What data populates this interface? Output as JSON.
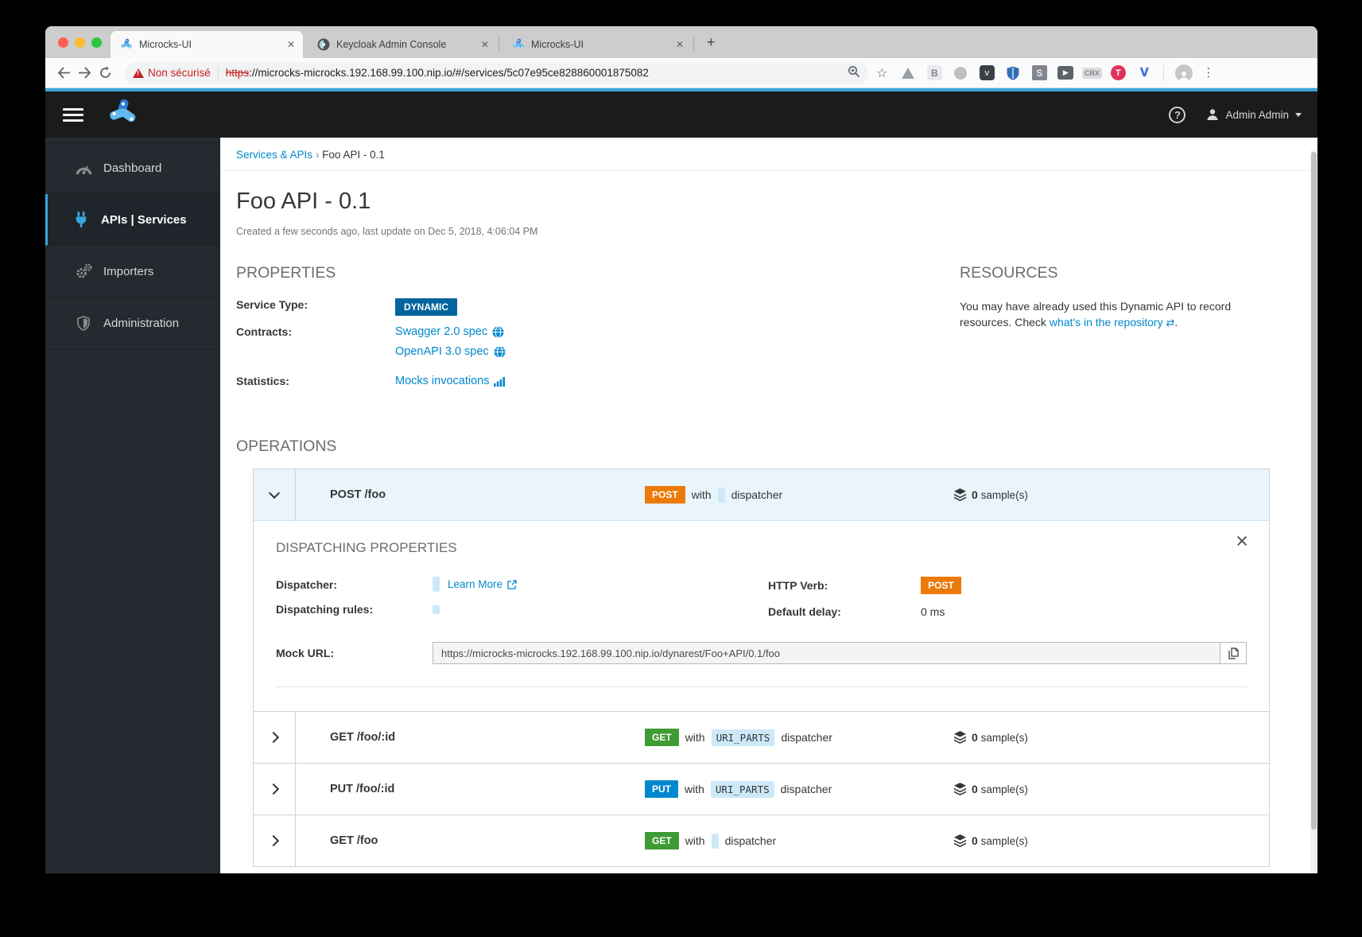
{
  "colors": {
    "accent": "#39a5dc",
    "link": "#0088ce",
    "method_get": "#3f9c35",
    "method_post": "#ec7a08",
    "method_put": "#0088ce",
    "dynamic_badge": "#00659c",
    "navbar_bg": "#1b1b1b",
    "sidebar_bg": "#252a30"
  },
  "browser": {
    "tabs": [
      {
        "title": "Microcks-UI",
        "close": "✕"
      },
      {
        "title": "Keycloak Admin Console",
        "close": "✕"
      },
      {
        "title": "Microcks-UI",
        "close": "✕"
      }
    ],
    "new_tab": "+",
    "security_chip": "Non sécurisé",
    "url_scheme": "https",
    "url_rest": "://microcks-microcks.192.168.99.100.nip.io/#/services/5c07e95ce828860001875082",
    "star": "☆",
    "extensions": {
      "b_label": "B",
      "pocket_glyph": "v",
      "s_label": "S",
      "rec_glyph": "▶",
      "crx_label": "CRX",
      "red_label": "T",
      "v_label": "V"
    },
    "kebab": "⋮"
  },
  "navbar": {
    "user": "Admin Admin",
    "help": "?"
  },
  "sidebar": {
    "items": [
      {
        "label": "Dashboard"
      },
      {
        "label": "APIs | Services"
      },
      {
        "label": "Importers"
      },
      {
        "label": "Administration"
      }
    ]
  },
  "breadcrumb": {
    "parent": "Services & APIs",
    "separator": "›",
    "current": "Foo API - 0.1"
  },
  "page": {
    "title": "Foo API - 0.1",
    "subtitle": "Created a few seconds ago, last update on Dec 5, 2018, 4:06:04 PM"
  },
  "properties": {
    "heading": "PROPERTIES",
    "service_type_label": "Service Type:",
    "service_type_value": "DYNAMIC",
    "contracts_label": "Contracts:",
    "contract_links": [
      "Swagger 2.0 spec",
      "OpenAPI 3.0 spec"
    ],
    "statistics_label": "Statistics:",
    "statistics_link": "Mocks invocations"
  },
  "resources": {
    "heading": "RESOURCES",
    "line1": "You may have already used this Dynamic API to record resources.",
    "line2_prefix": "Check ",
    "line2_link": "what's in the repository",
    "line2_icon": "⇄",
    "line2_suffix": "."
  },
  "operations": {
    "heading": "OPERATIONS",
    "rows": [
      {
        "name": "POST /foo",
        "method": "POST",
        "connector": "with",
        "rule": "",
        "dispatcher": "dispatcher",
        "samples_count": "0",
        "samples_label": "sample(s)"
      },
      {
        "name": "GET /foo/:id",
        "method": "GET",
        "connector": "with",
        "rule": "URI_PARTS",
        "dispatcher": "dispatcher",
        "samples_count": "0",
        "samples_label": "sample(s)"
      },
      {
        "name": "PUT /foo/:id",
        "method": "PUT",
        "connector": "with",
        "rule": "URI_PARTS",
        "dispatcher": "dispatcher",
        "samples_count": "0",
        "samples_label": "sample(s)"
      },
      {
        "name": "GET /foo",
        "method": "GET",
        "connector": "with",
        "rule": "",
        "dispatcher": "dispatcher",
        "samples_count": "0",
        "samples_label": "sample(s)"
      }
    ],
    "panel": {
      "heading": "DISPATCHING PROPERTIES",
      "close": "×",
      "dispatcher_label": "Dispatcher:",
      "learn_more": "Learn More",
      "rules_label": "Dispatching rules:",
      "http_verb_label": "HTTP Verb:",
      "http_verb": "POST",
      "delay_label": "Default delay:",
      "delay_value": "0 ms",
      "mock_url_label": "Mock URL:",
      "mock_url": "https://microcks-microcks.192.168.99.100.nip.io/dynarest/Foo+API/0.1/foo"
    }
  }
}
